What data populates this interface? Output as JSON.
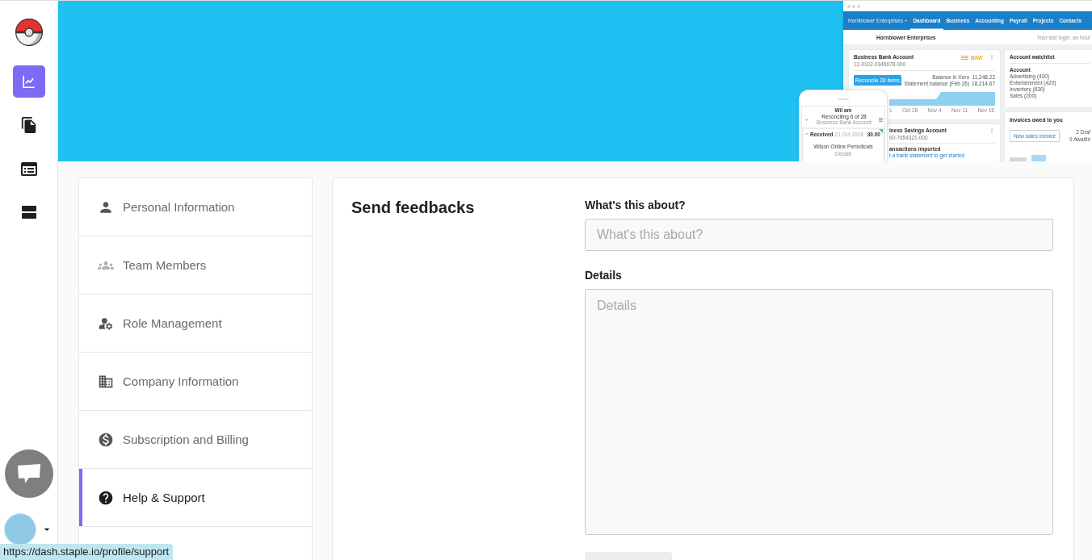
{
  "sidebar": {
    "nav_items": [
      {
        "selected": true
      },
      {
        "selected": false
      },
      {
        "selected": false
      },
      {
        "selected": false
      }
    ]
  },
  "banner": {
    "app_preview": {
      "org_menu": "Hornblower Enterprises",
      "tabs": [
        {
          "label": "Dashboard",
          "selected": true
        },
        {
          "label": "Business",
          "selected": false
        },
        {
          "label": "Accounting",
          "selected": false
        },
        {
          "label": "Payroll",
          "selected": false
        },
        {
          "label": "Projects",
          "selected": false
        },
        {
          "label": "Contacts",
          "selected": false
        }
      ],
      "page_title": "Hornblower Enterprises",
      "last_login": "Your last login: an hour",
      "bank_card": {
        "title": "Business Bank Account",
        "account_number": "12-0102-0345678-000",
        "logo": "BNK",
        "button": "Reconcile 28 items",
        "balances": [
          {
            "label": "Balance in Xero",
            "value": "11,248.22"
          },
          {
            "label": "Statement balance (Feb 26)",
            "value": "18,214.67"
          }
        ],
        "axis_labels": [
          "1",
          "Oct 28",
          "Nov 4",
          "Nov 11",
          "Nov 18"
        ]
      },
      "savings_card": {
        "title": "iness Savings Account",
        "account_number": "90-7654321-000",
        "notice_title": "ansactions imported",
        "notice_link": "t a bank statement to get started"
      },
      "watchlist_card": {
        "title": "Account watchlist",
        "column": "Account",
        "rows": [
          "Advertising (400)",
          "Entertainment (420)",
          "Inventory (630)",
          "Sales (200)"
        ]
      },
      "invoices_card": {
        "title": "Invoices owed to you",
        "button": "New sales invoice",
        "stats": [
          "2 Draf",
          "9 Awaitin"
        ]
      }
    },
    "phone_preview": {
      "time": "Wil am",
      "title": "Reconciling 6 of 28",
      "subtitle": "Business Bank Account",
      "transaction": {
        "status": "Received",
        "date": "21 Oct 2018",
        "amount": "30.00",
        "payee": "Wilson Online Periodicals",
        "link": "Details"
      }
    }
  },
  "settings_menu": {
    "items": [
      {
        "label": "Personal Information",
        "selected": false
      },
      {
        "label": "Team Members",
        "selected": false
      },
      {
        "label": "Role Management",
        "selected": false
      },
      {
        "label": "Company Information",
        "selected": false
      },
      {
        "label": "Subscription and Billing",
        "selected": false
      },
      {
        "label": "Help & Support",
        "selected": true
      }
    ]
  },
  "feedback_form": {
    "title": "Send feedbacks",
    "fields": [
      {
        "kind": "input",
        "label": "What's this about?",
        "placeholder": "What's this about?"
      },
      {
        "kind": "textarea",
        "label": "Details",
        "placeholder": "Details"
      }
    ]
  },
  "status_bar": {
    "url": "https://dash.staple.io/profile/support"
  }
}
